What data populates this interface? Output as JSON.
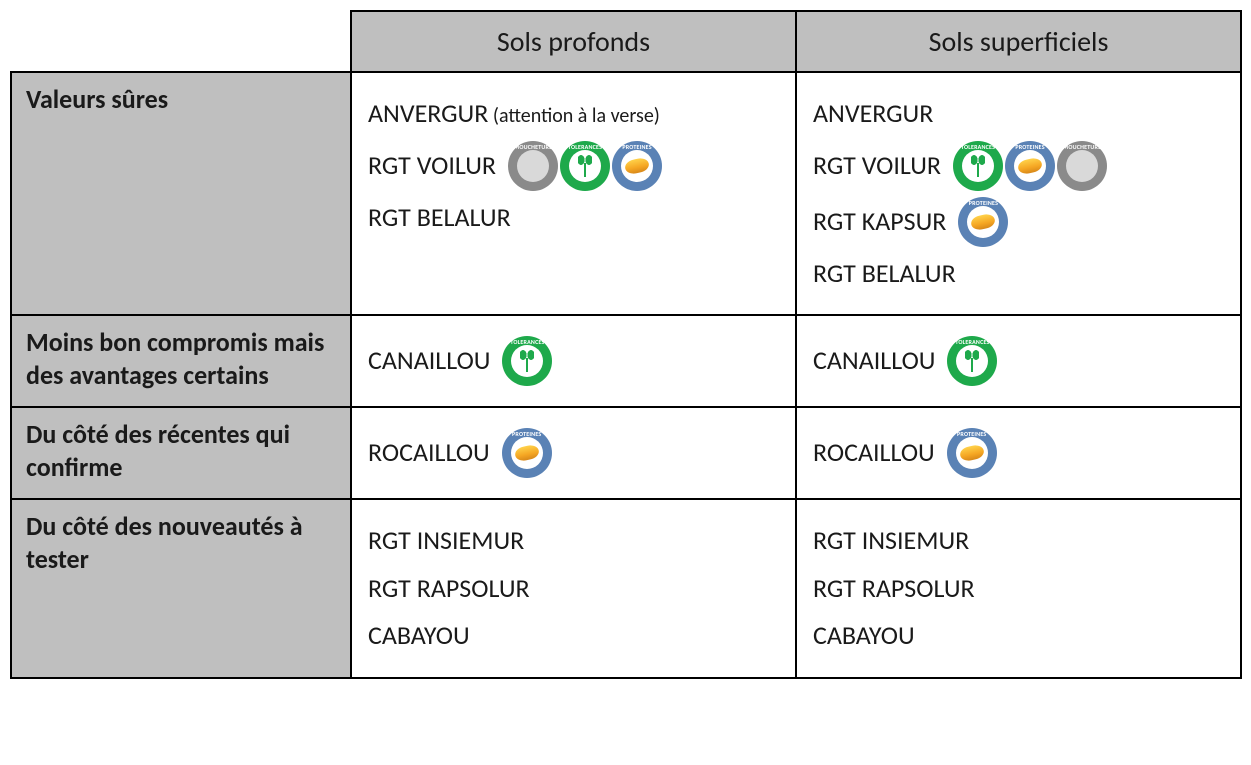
{
  "columns": [
    "Sols profonds",
    "Sols superficiels"
  ],
  "badge_labels": {
    "moucheture": "MOUCHETURE",
    "tolerances": "TOLERANCES",
    "proteines": "PROTEINES"
  },
  "rows": [
    {
      "label": "Valeurs sûres",
      "cells": [
        [
          {
            "name": "ANVERGUR",
            "note": "(attention à la verse)",
            "badges": []
          },
          {
            "name": "RGT VOILUR",
            "badges": [
              "moucheture",
              "tolerances",
              "proteines"
            ]
          },
          {
            "name": "RGT BELALUR",
            "badges": []
          }
        ],
        [
          {
            "name": "ANVERGUR",
            "badges": []
          },
          {
            "name": "RGT VOILUR",
            "badges": [
              "tolerances",
              "proteines",
              "moucheture"
            ]
          },
          {
            "name": "RGT KAPSUR",
            "badges": [
              "proteines"
            ]
          },
          {
            "name": "RGT BELALUR",
            "badges": []
          }
        ]
      ]
    },
    {
      "label": "Moins bon compromis mais des avantages certains",
      "cells": [
        [
          {
            "name": "CANAILLOU",
            "badges": [
              "tolerances"
            ]
          }
        ],
        [
          {
            "name": "CANAILLOU",
            "badges": [
              "tolerances"
            ]
          }
        ]
      ]
    },
    {
      "label": "Du côté des récentes qui confirme",
      "cells": [
        [
          {
            "name": "ROCAILLOU",
            "badges": [
              "proteines"
            ]
          }
        ],
        [
          {
            "name": "ROCAILLOU",
            "badges": [
              "proteines"
            ]
          }
        ]
      ]
    },
    {
      "label": "Du côté des nouveautés à tester",
      "cells": [
        [
          {
            "name": "RGT INSIEMUR",
            "badges": []
          },
          {
            "name": "RGT RAPSOLUR",
            "badges": []
          },
          {
            "name": "CABAYOU",
            "badges": []
          }
        ],
        [
          {
            "name": "RGT INSIEMUR",
            "badges": []
          },
          {
            "name": "RGT RAPSOLUR",
            "badges": []
          },
          {
            "name": "CABAYOU",
            "badges": []
          }
        ]
      ]
    }
  ]
}
